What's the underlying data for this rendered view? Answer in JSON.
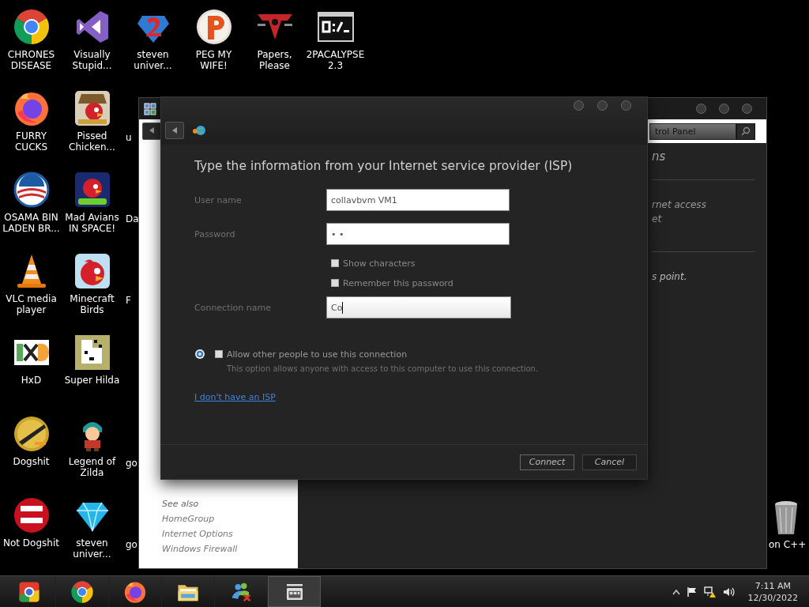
{
  "desktop": {
    "columns": [
      [
        {
          "kind": "chrome",
          "label": "CHRONES DISEASE"
        },
        {
          "kind": "firefox",
          "label": "FURRY CUCKS"
        },
        {
          "kind": "ring-logo",
          "label": "OSAMA BIN LADEN BR..."
        },
        {
          "kind": "cone",
          "label": "VLC media player"
        },
        {
          "kind": "hxd",
          "label": "HxD"
        },
        {
          "kind": "gold-disc",
          "label": "Dogshit"
        },
        {
          "kind": "red-badge",
          "label": "Not Dogshit"
        }
      ],
      [
        {
          "kind": "ribbon",
          "label": "Visually Stupid..."
        },
        {
          "kind": "bird-card",
          "label": "Pissed Chicken..."
        },
        {
          "kind": "bird-space",
          "label": "Mad Avians IN SPACE!"
        },
        {
          "kind": "bird",
          "label": "Minecraft Birds"
        },
        {
          "kind": "pixel",
          "label": "Super Hilda"
        },
        {
          "kind": "character",
          "label": "Legend of Zilda"
        },
        {
          "kind": "diamond",
          "label": "steven univer..."
        }
      ],
      [
        {
          "kind": "gem",
          "label": "steven univer..."
        },
        {
          "kind": "covered",
          "label": "u"
        },
        {
          "kind": "covered",
          "label": "Da"
        },
        {
          "kind": "covered",
          "label": "F"
        },
        {
          "kind": "empty"
        },
        {
          "kind": "covered",
          "label": "go"
        },
        {
          "kind": "covered",
          "label": "go"
        }
      ],
      [
        {
          "kind": "ball",
          "label": "PEG MY WIFE!"
        }
      ],
      [
        {
          "kind": "emblem",
          "label": "Papers, Please"
        }
      ],
      [
        {
          "kind": "terminal",
          "label": "2PACALYPSE 2.3"
        }
      ]
    ],
    "recycle_bin": {
      "label": "on C++"
    }
  },
  "control_panel": {
    "search": {
      "value": "trol Panel"
    },
    "heading": "ns",
    "tasks": [
      "rnet access",
      "et"
    ],
    "note": "s point.",
    "see_also": {
      "title": "See also",
      "links": [
        "HomeGroup",
        "Internet Options",
        "Windows Firewall"
      ]
    }
  },
  "dialog": {
    "heading": "Type the information from your Internet service provider (ISP)",
    "fields": [
      {
        "label": "User name",
        "value": "collavbvm VM1",
        "focused": false
      },
      {
        "label": "Password",
        "value": "• •",
        "focused": false
      }
    ],
    "checkboxes": [
      {
        "label": "Show characters",
        "checked": false
      },
      {
        "label": "Remember this password",
        "checked": false
      }
    ],
    "connection_name": {
      "label": "Connection name",
      "value": "Co",
      "focused": true
    },
    "share": {
      "label": "Allow other people to use this connection",
      "checked": false,
      "description": "This option allows anyone with access to this computer to use this connection."
    },
    "link": "I don't have an ISP",
    "buttons": [
      {
        "label": "Connect",
        "default": true
      },
      {
        "label": "Cancel",
        "default": false
      }
    ]
  },
  "taskbar": {
    "apps": [
      {
        "kind": "browser-square",
        "active": false
      },
      {
        "kind": "chrome",
        "active": false
      },
      {
        "kind": "firefox",
        "active": false
      },
      {
        "kind": "folder",
        "active": false
      },
      {
        "kind": "people",
        "active": false
      },
      {
        "kind": "archive",
        "active": true
      }
    ],
    "clock": {
      "time": "7:11 AM",
      "date": "12/30/2022"
    }
  }
}
